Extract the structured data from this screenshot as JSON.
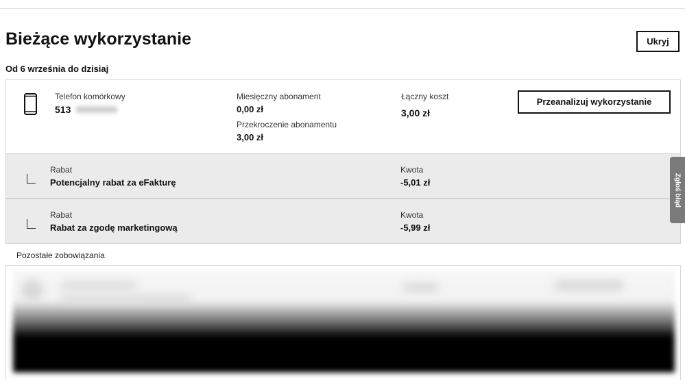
{
  "header": {
    "title": "Bieżące wykorzystanie",
    "hide_label": "Ukryj",
    "period": "Od 6 września do dzisiaj"
  },
  "usage": {
    "device_label": "Telefon komórkowy",
    "number_prefix": "513",
    "monthly_label": "Miesięczny abonament",
    "monthly_value": "0,00 zł",
    "overage_label": "Przekroczenie abonamentu",
    "overage_value": "3,00 zł",
    "total_label": "Łączny koszt",
    "total_value": "3,00 zł",
    "analyze_label": "Przeanalizuj wykorzystanie"
  },
  "discounts": [
    {
      "type_label": "Rabat",
      "name": "Potencjalny rabat za eFakturę",
      "amount_label": "Kwota",
      "amount": "-5,01 zł"
    },
    {
      "type_label": "Rabat",
      "name": "Rabat za zgodę marketingową",
      "amount_label": "Kwota",
      "amount": "-5,99 zł"
    }
  ],
  "other": {
    "label": "Pozostałe zobowiązania"
  },
  "feedback": {
    "label": "Zgłoś błąd"
  }
}
